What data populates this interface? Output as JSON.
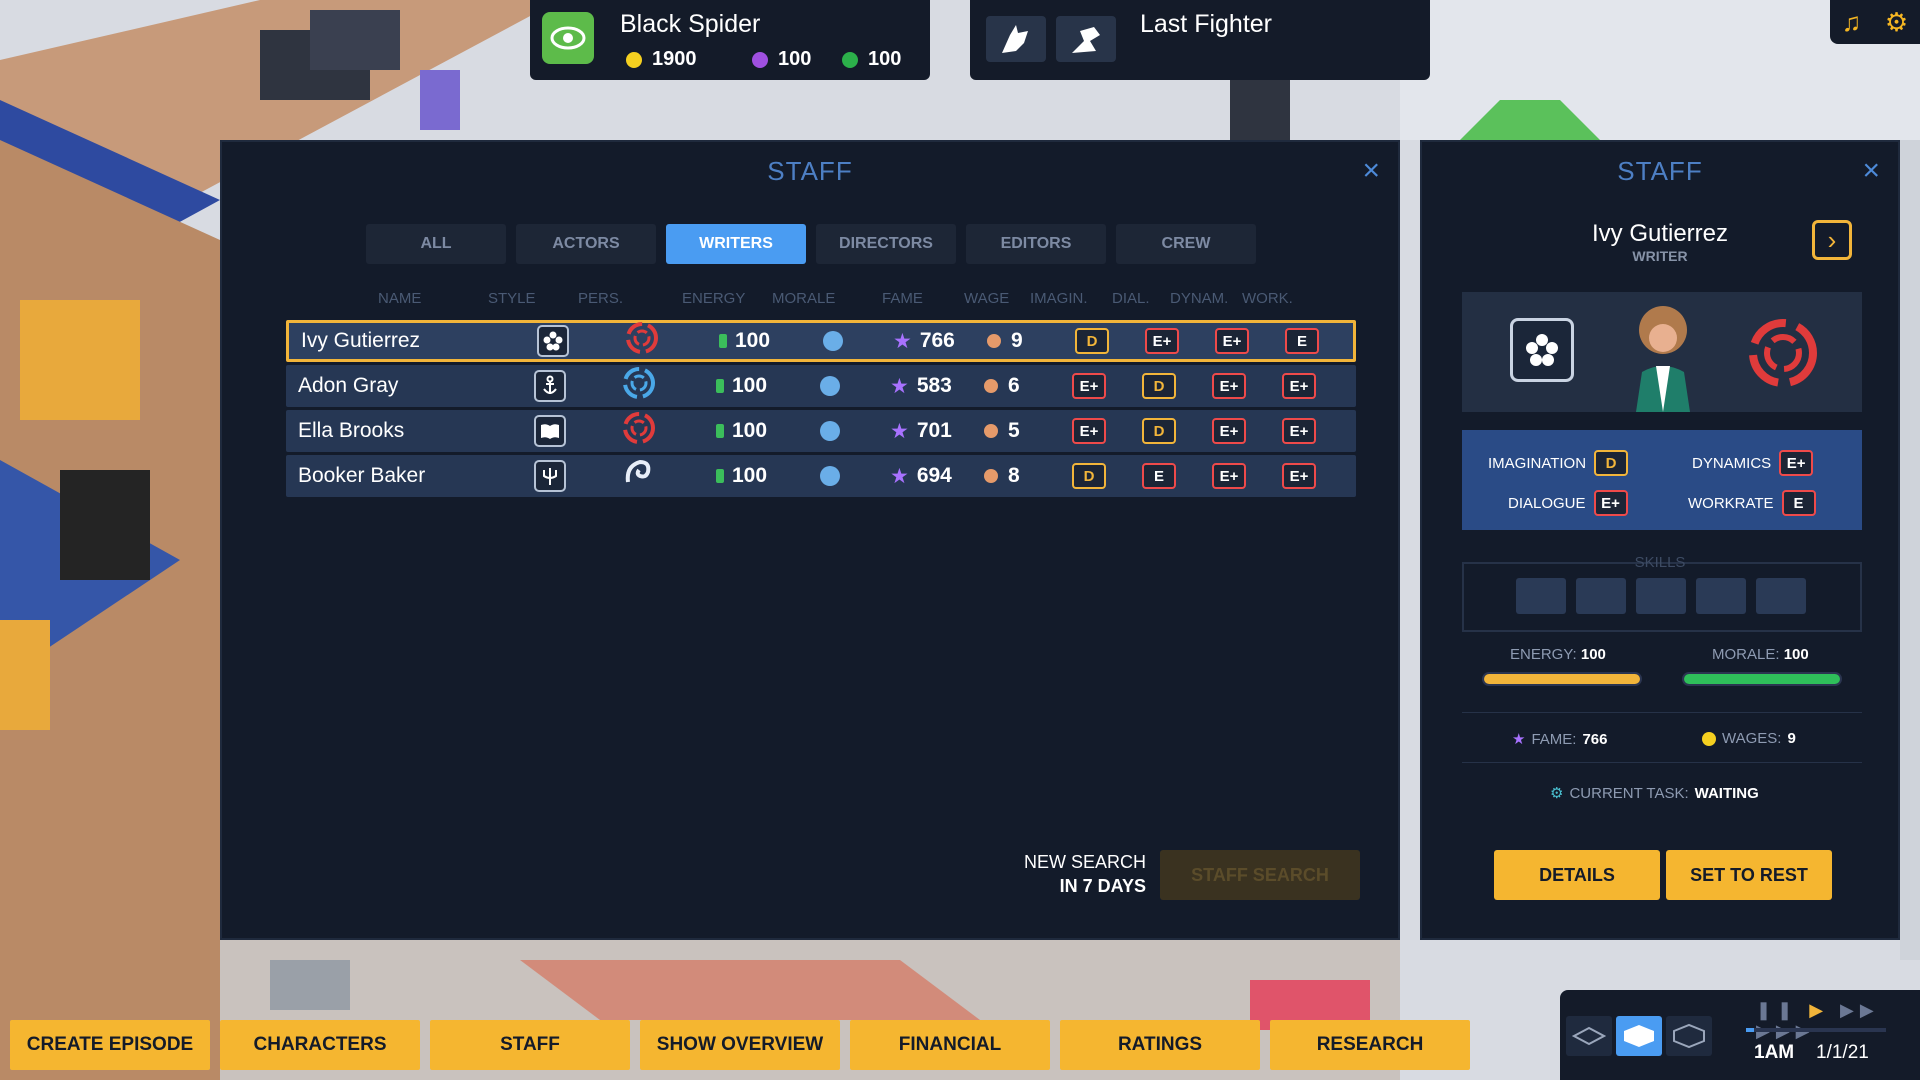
{
  "top": {
    "show_left": {
      "title": "Black Spider",
      "money": "1900",
      "purple": "100",
      "green": "100"
    },
    "show_right": {
      "title": "Last Fighter"
    },
    "icons": [
      "music-icon",
      "settings-gear-icon"
    ]
  },
  "staff_panel": {
    "title": "STAFF",
    "close": "×",
    "tabs": [
      "ALL",
      "ACTORS",
      "WRITERS",
      "DIRECTORS",
      "EDITORS",
      "CREW"
    ],
    "active_tab": "WRITERS",
    "columns": [
      "NAME",
      "STYLE",
      "PERS.",
      "ENERGY",
      "MORALE",
      "FAME",
      "WAGE",
      "IMAGIN.",
      "DIAL.",
      "DYNAM.",
      "WORK."
    ],
    "rows": [
      {
        "name": "Ivy Gutierrez",
        "style_icon": "flower-icon",
        "pers_icon": "red-swirl-icon",
        "energy": "100",
        "fame": "766",
        "wage": "9",
        "imagin": "D",
        "dial": "E+",
        "dynam": "E+",
        "work": "E"
      },
      {
        "name": "Adon Gray",
        "style_icon": "anchor-icon",
        "pers_icon": "blue-swirl-icon",
        "energy": "100",
        "fame": "583",
        "wage": "6",
        "imagin": "E+",
        "dial": "D",
        "dynam": "E+",
        "work": "E+"
      },
      {
        "name": "Ella Brooks",
        "style_icon": "book-icon",
        "pers_icon": "red-swirl-icon",
        "energy": "100",
        "fame": "701",
        "wage": "5",
        "imagin": "E+",
        "dial": "D",
        "dynam": "E+",
        "work": "E+"
      },
      {
        "name": "Booker Baker",
        "style_icon": "trident-icon",
        "pers_icon": "wave-icon",
        "energy": "100",
        "fame": "694",
        "wage": "8",
        "imagin": "D",
        "dial": "E",
        "dynam": "E+",
        "work": "E+"
      }
    ],
    "selected_row": 0,
    "new_search_line1": "NEW SEARCH",
    "new_search_line2": "IN 7 DAYS",
    "staff_search": "STAFF SEARCH"
  },
  "detail_panel": {
    "title": "STAFF",
    "close": "×",
    "name": "Ivy Gutierrez",
    "role": "WRITER",
    "stats": {
      "imagination_label": "IMAGINATION",
      "imagination": "D",
      "dynamics_label": "DYNAMICS",
      "dynamics": "E+",
      "dialogue_label": "DIALOGUE",
      "dialogue": "E+",
      "workrate_label": "WORKRATE",
      "workrate": "E"
    },
    "skills_label": "SKILLS",
    "energy_label": "ENERGY:",
    "energy": "100",
    "energy_fraction": 1.0,
    "morale_label": "MORALE:",
    "morale": "100",
    "morale_fraction": 1.0,
    "fame_label": "FAME:",
    "fame": "766",
    "wages_label": "WAGES:",
    "wages": "9",
    "task_label": "CURRENT TASK:",
    "task": "WAITING",
    "details_button": "DETAILS",
    "rest_button": "SET TO REST"
  },
  "bottom_nav": [
    "CREATE EPISODE",
    "CHARACTERS",
    "STAFF",
    "SHOW OVERVIEW",
    "FINANCIAL",
    "RATINGS",
    "RESEARCH"
  ],
  "time": {
    "clock": "1AM",
    "date": "1/1/21"
  },
  "colors": {
    "accent_blue": "#4a9cf2",
    "accent_yellow": "#f5b630",
    "panel_bg": "#131b2a",
    "grade_red": "#ef4a4a",
    "grade_yellow": "#f2b53a"
  }
}
